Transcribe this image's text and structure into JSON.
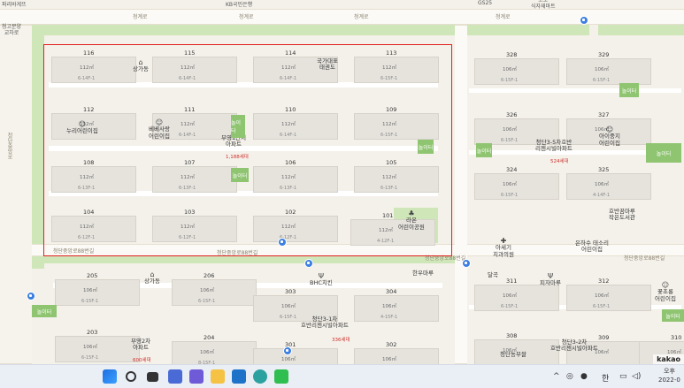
{
  "top_labels": {
    "left_top": "파리바게뜨",
    "center_top": "KB국민은행",
    "gs": "GS25",
    "coco": "코코\n식자재마트",
    "school": "청고분양\n교차로"
  },
  "roads": {
    "north1": "청계로",
    "north2": "청계로",
    "north3": "청계로",
    "north4": "청계로",
    "mid_left": "청단중앙로88번길",
    "mid_center": "청단중앙로88번길",
    "mid_right": "청단중앙로88번길",
    "mid_far": "청단중앙로88번길",
    "side_left": "청단중앙로"
  },
  "blocks": [
    {
      "n": "116",
      "a": "112㎡",
      "addr": "6-14F-1"
    },
    {
      "n": "115",
      "a": "112㎡",
      "addr": "6-14F-1"
    },
    {
      "n": "114",
      "a": "112㎡",
      "addr": "6-14F-1"
    },
    {
      "n": "113",
      "a": "112㎡",
      "addr": "6-15F-1"
    },
    {
      "n": "112",
      "a": "112㎡",
      "addr": ""
    },
    {
      "n": "111",
      "a": "112㎡",
      "addr": "6-14F-1"
    },
    {
      "n": "110",
      "a": "112㎡",
      "addr": "6-14F-1"
    },
    {
      "n": "109",
      "a": "112㎡",
      "addr": "6-15F-1"
    },
    {
      "n": "108",
      "a": "112㎡",
      "addr": "6-13F-1"
    },
    {
      "n": "107",
      "a": "112㎡",
      "addr": "6-13F-1"
    },
    {
      "n": "106",
      "a": "112㎡",
      "addr": "6-13F-1"
    },
    {
      "n": "105",
      "a": "112㎡",
      "addr": "6-13F-1"
    },
    {
      "n": "104",
      "a": "112㎡",
      "addr": "6-12F-1"
    },
    {
      "n": "103",
      "a": "112㎡",
      "addr": "6-12F-1"
    },
    {
      "n": "102",
      "a": "112㎡",
      "addr": "6-12F-1"
    },
    {
      "n": "101",
      "a": "112㎡",
      "addr": "4-12F-1"
    },
    {
      "n": "328",
      "a": "106㎡",
      "addr": "6-15F-1"
    },
    {
      "n": "329",
      "a": "106㎡",
      "addr": "6-15F-1"
    },
    {
      "n": "326",
      "a": "106㎡",
      "addr": "6-15F-1"
    },
    {
      "n": "327",
      "a": "106㎡",
      "addr": ""
    },
    {
      "n": "324",
      "a": "106㎡",
      "addr": "6-15F-1"
    },
    {
      "n": "325",
      "a": "106㎡",
      "addr": "4-14F-1"
    },
    {
      "n": "205",
      "a": "106㎡",
      "addr": "6-15F-1"
    },
    {
      "n": "206",
      "a": "106㎡",
      "addr": "6-15F-1"
    },
    {
      "n": "303",
      "a": "106㎡",
      "addr": "6-15F-1"
    },
    {
      "n": "304",
      "a": "106㎡",
      "addr": "4-15F-1"
    },
    {
      "n": "311",
      "a": "106㎡",
      "addr": "6-15F-1"
    },
    {
      "n": "312",
      "a": "106㎡",
      "addr": "6-15F-1"
    },
    {
      "n": "203",
      "a": "106㎡",
      "addr": "6-15F-1"
    },
    {
      "n": "204",
      "a": "106㎡",
      "addr": "8-15F-1"
    },
    {
      "n": "301",
      "a": "106㎡",
      "addr": ""
    },
    {
      "n": "302",
      "a": "106㎡",
      "addr": ""
    },
    {
      "n": "308",
      "a": "106㎡",
      "addr": ""
    },
    {
      "n": "309",
      "a": "106㎡",
      "addr": ""
    },
    {
      "n": "310",
      "a": "106㎡",
      "addr": ""
    }
  ],
  "pois": {
    "sangga1": "상가동",
    "gukga": "국가대표\n태권도",
    "nuri": "누리어린이집",
    "bebe": "베베사랑\n어린이집",
    "apt1": "부영1단지\n아파트",
    "apt1_units": "1,188세대",
    "hwan": "호반꿈마루\n작은도서관",
    "lion": "라온\n어린이공원",
    "ase": "아세기\n치과의원",
    "eunha": "은하수 태소리\n어린이집",
    "aijung": "아이중지\n어린이집",
    "hoban2": "청단3-5차호반\n리젠시빌아파트",
    "hoban2_units": "524세대",
    "sangga2": "상가동",
    "bhc": "BHC치킨",
    "hanwoo": "한우마루",
    "dalgok": "달곡",
    "pizza": "피자마루",
    "kkoch": "꽃초롱\n어린이집",
    "hoban1": "청단3-1차\n호반리젠시빌아파트",
    "hoban1_units": "336세대",
    "apt2": "부영2차\n아파트",
    "apt2_units": "600세대",
    "hoban3": "청단3-2차\n호반리젠시빌아파트",
    "nongbu": "청단농부쌀",
    "playground": "놀이터"
  },
  "taskbar": {
    "lang": "한",
    "time": "오후",
    "date": "2022-0"
  },
  "brand": "kakao"
}
